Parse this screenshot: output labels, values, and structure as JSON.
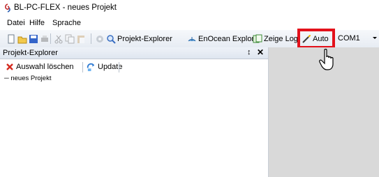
{
  "window": {
    "title": "BL-PC-FLEX - neues Projekt",
    "icon": "app-swirl-icon"
  },
  "menu": {
    "items": [
      "Datei",
      "Hilfe",
      "Sprache"
    ]
  },
  "toolbar": {
    "project_explorer_label": "Projekt-Explorer",
    "enocean_explorer_label": "EnOcean Explorer",
    "show_log_label": "Zeige Log",
    "auto_label": "Auto",
    "port_value": "COM1"
  },
  "explorer": {
    "title": "Projekt-Explorer",
    "pin_glyph": "↕",
    "close_glyph": "✕",
    "clear_selection_label": "Auswahl löschen",
    "update_label": "Update",
    "tree": [
      "─ neues Projekt"
    ]
  },
  "colors": {
    "highlight": "#e3111b",
    "right_pane": "#d9d9d9"
  }
}
